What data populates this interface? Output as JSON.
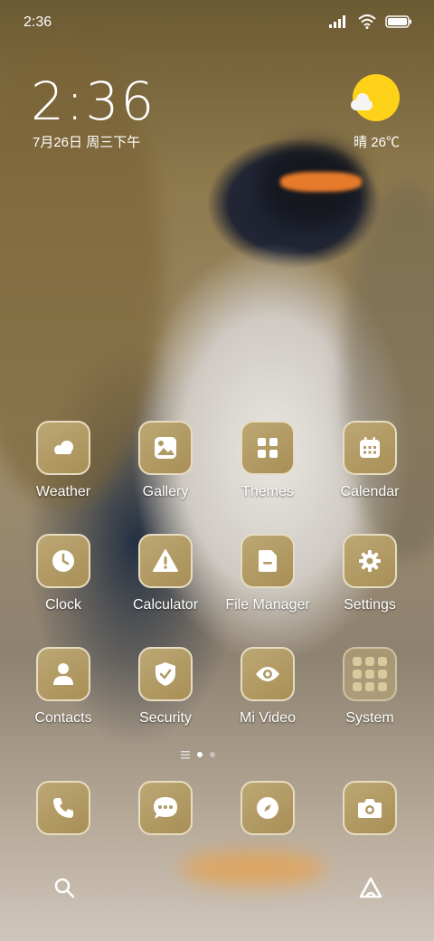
{
  "status_bar": {
    "time": "2:36"
  },
  "lock_clock": {
    "time": "2:36",
    "date": "7月26日 周三下午"
  },
  "weather_widget": {
    "text": "晴 26℃"
  },
  "apps": [
    {
      "label": "Weather",
      "icon": "cloud-icon"
    },
    {
      "label": "Gallery",
      "icon": "image-icon"
    },
    {
      "label": "Themes",
      "icon": "grid-icon"
    },
    {
      "label": "Calendar",
      "icon": "calendar-icon"
    },
    {
      "label": "Clock",
      "icon": "clock-icon"
    },
    {
      "label": "Calculator",
      "icon": "warning-icon"
    },
    {
      "label": "File Manager",
      "icon": "folder-icon"
    },
    {
      "label": "Settings",
      "icon": "gear-icon"
    },
    {
      "label": "Contacts",
      "icon": "person-icon"
    },
    {
      "label": "Security",
      "icon": "shield-icon"
    },
    {
      "label": "Mi Video",
      "icon": "eye-icon"
    },
    {
      "label": "System",
      "icon": "folder-icon"
    }
  ],
  "dock": [
    {
      "icon": "phone-icon"
    },
    {
      "icon": "message-icon"
    },
    {
      "icon": "compass-icon"
    },
    {
      "icon": "camera-icon"
    }
  ],
  "colors": {
    "icon_gold": "#b09a64",
    "sun": "#ffd21a"
  }
}
